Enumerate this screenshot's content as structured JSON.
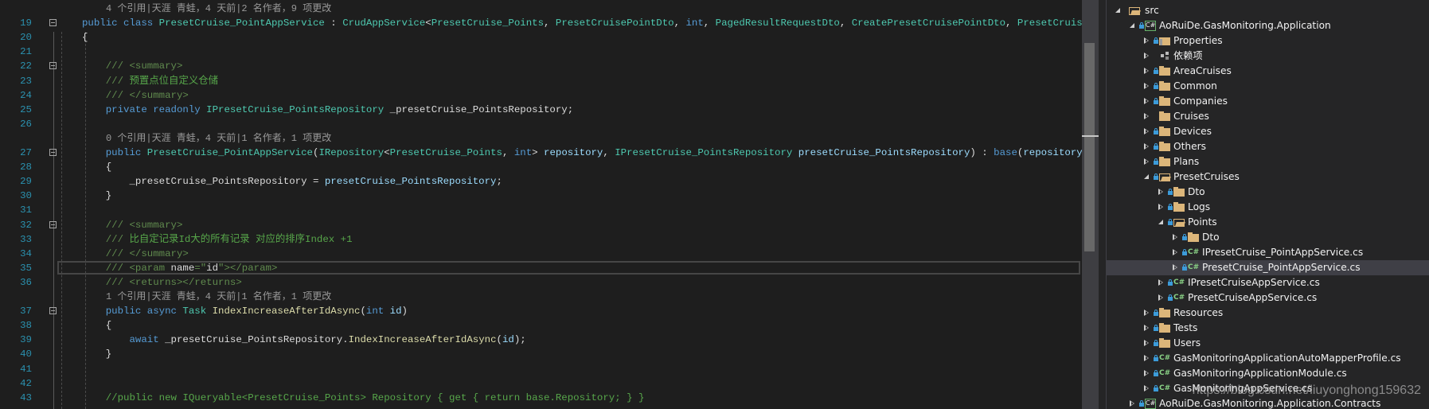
{
  "colors": {
    "background": "#1e1e1e",
    "line_number": "#2b91af",
    "keyword": "#569cd6",
    "type": "#4ec9b0",
    "comment": "#57a64a",
    "selection": "#3f3f46"
  },
  "editor": {
    "rows": [
      {
        "kind": "lens",
        "text": "4 个引用|天涯 青蛙，4 天前|2 名作者，9 项更改",
        "indent": "    "
      },
      {
        "num": "19",
        "fold": true,
        "tokens": [
          [
            "kw",
            "public class "
          ],
          [
            "ty",
            "PresetCruise_PointAppService"
          ],
          [
            "pl",
            " : "
          ],
          [
            "ty",
            "CrudAppService"
          ],
          [
            "pl",
            "<"
          ],
          [
            "ty",
            "PresetCruise_Points"
          ],
          [
            "pl",
            ", "
          ],
          [
            "ty",
            "PresetCruisePointDto"
          ],
          [
            "pl",
            ", "
          ],
          [
            "kw",
            "int"
          ],
          [
            "pl",
            ", "
          ],
          [
            "ty",
            "PagedResultRequestDto"
          ],
          [
            "pl",
            ", "
          ],
          [
            "ty",
            "CreatePresetCruisePointDto"
          ],
          [
            "pl",
            ", "
          ],
          [
            "ty",
            "PresetCruiseP"
          ]
        ]
      },
      {
        "num": "20",
        "tokens": [
          [
            "pl",
            "{"
          ]
        ]
      },
      {
        "num": "21",
        "tokens": []
      },
      {
        "num": "22",
        "fold": true,
        "tokens": [
          [
            "xd",
            "    /// <summary>"
          ]
        ]
      },
      {
        "num": "23",
        "tokens": [
          [
            "xd",
            "    /// "
          ],
          [
            "cm",
            "预置点位自定义仓储"
          ]
        ]
      },
      {
        "num": "24",
        "tokens": [
          [
            "xd",
            "    /// </summary>"
          ]
        ]
      },
      {
        "num": "25",
        "tokens": [
          [
            "kw",
            "    private readonly "
          ],
          [
            "ty",
            "IPresetCruise_PointsRepository"
          ],
          [
            "pl",
            " _presetCruise_PointsRepository;"
          ]
        ]
      },
      {
        "num": "26",
        "tokens": []
      },
      {
        "kind": "lens",
        "text": "0 个引用|天涯 青蛙，4 天前|1 名作者，1 项更改",
        "indent": "    "
      },
      {
        "num": "27",
        "fold": true,
        "tokens": [
          [
            "kw",
            "    public "
          ],
          [
            "ty",
            "PresetCruise_PointAppService"
          ],
          [
            "pl",
            "("
          ],
          [
            "ty",
            "IRepository"
          ],
          [
            "pl",
            "<"
          ],
          [
            "ty",
            "PresetCruise_Points"
          ],
          [
            "pl",
            ", "
          ],
          [
            "kw",
            "int"
          ],
          [
            "pl",
            "> "
          ],
          [
            "pa",
            "repository"
          ],
          [
            "pl",
            ", "
          ],
          [
            "ty",
            "IPresetCruise_PointsRepository"
          ],
          [
            "pa",
            " presetCruise_PointsRepository"
          ],
          [
            "pl",
            ") : "
          ],
          [
            "kw",
            "base"
          ],
          [
            "pl",
            "("
          ],
          [
            "pa",
            "repository"
          ],
          [
            "pl",
            ")"
          ]
        ]
      },
      {
        "num": "28",
        "tokens": [
          [
            "pl",
            "    {"
          ]
        ]
      },
      {
        "num": "29",
        "tokens": [
          [
            "pl",
            "        _presetCruise_PointsRepository = "
          ],
          [
            "pa",
            "presetCruise_PointsRepository"
          ],
          [
            "pl",
            ";"
          ]
        ]
      },
      {
        "num": "30",
        "tokens": [
          [
            "pl",
            "    }"
          ]
        ]
      },
      {
        "num": "31",
        "tokens": []
      },
      {
        "num": "32",
        "fold": true,
        "tokens": [
          [
            "xd",
            "    /// <summary>"
          ]
        ]
      },
      {
        "num": "33",
        "tokens": [
          [
            "xd",
            "    /// "
          ],
          [
            "cm",
            "比自定记录Id大的所有记录 对应的排序Index +1"
          ]
        ]
      },
      {
        "num": "34",
        "tokens": [
          [
            "xd",
            "    /// </summary>"
          ]
        ]
      },
      {
        "num": "35",
        "current": true,
        "tokens": [
          [
            "xd",
            "    /// <param "
          ],
          [
            "pl",
            "name"
          ],
          [
            "xd",
            "=\""
          ],
          [
            "pl",
            "id"
          ],
          [
            "xd",
            "\"></param>"
          ]
        ]
      },
      {
        "num": "36",
        "tokens": [
          [
            "xd",
            "    /// <returns></returns>"
          ]
        ]
      },
      {
        "kind": "lens",
        "text": "1 个引用|天涯 青蛙，4 天前|1 名作者，1 项更改",
        "indent": "    "
      },
      {
        "num": "37",
        "fold": true,
        "tokens": [
          [
            "kw",
            "    public async "
          ],
          [
            "ty",
            "Task"
          ],
          [
            "mt",
            " IndexIncreaseAfterIdAsync"
          ],
          [
            "pl",
            "("
          ],
          [
            "kw",
            "int"
          ],
          [
            "pa",
            " id"
          ],
          [
            "pl",
            ")"
          ]
        ]
      },
      {
        "num": "38",
        "tokens": [
          [
            "pl",
            "    {"
          ]
        ]
      },
      {
        "num": "39",
        "tokens": [
          [
            "kw",
            "        await"
          ],
          [
            "pl",
            " _presetCruise_PointsRepository."
          ],
          [
            "mt",
            "IndexIncreaseAfterIdAsync"
          ],
          [
            "pl",
            "("
          ],
          [
            "pa",
            "id"
          ],
          [
            "pl",
            ");"
          ]
        ]
      },
      {
        "num": "40",
        "tokens": [
          [
            "pl",
            "    }"
          ]
        ]
      },
      {
        "num": "41",
        "tokens": []
      },
      {
        "num": "42",
        "tokens": []
      },
      {
        "num": "43",
        "tokens": [
          [
            "cm",
            "    //public new IQueryable<PresetCruise_Points> Repository { get { return base.Repository; } }"
          ]
        ]
      }
    ]
  },
  "solution_explorer": {
    "items": [
      {
        "level": 0,
        "exp": "expanded",
        "lock": false,
        "icon": "folder-open",
        "label": "src"
      },
      {
        "level": 1,
        "exp": "expanded",
        "lock": true,
        "icon": "cs-project",
        "label": "AoRuiDe.GasMonitoring.Application"
      },
      {
        "level": 2,
        "exp": "collapsed",
        "lock": true,
        "icon": "properties",
        "label": "Properties"
      },
      {
        "level": 2,
        "exp": "collapsed",
        "lock": false,
        "icon": "dependencies",
        "label": "依赖项"
      },
      {
        "level": 2,
        "exp": "collapsed",
        "lock": true,
        "icon": "folder",
        "label": "AreaCruises"
      },
      {
        "level": 2,
        "exp": "collapsed",
        "lock": true,
        "icon": "folder",
        "label": "Common"
      },
      {
        "level": 2,
        "exp": "collapsed",
        "lock": true,
        "icon": "folder",
        "label": "Companies"
      },
      {
        "level": 2,
        "exp": "collapsed",
        "lock": false,
        "icon": "folder",
        "label": "Cruises"
      },
      {
        "level": 2,
        "exp": "collapsed",
        "lock": true,
        "icon": "folder",
        "label": "Devices"
      },
      {
        "level": 2,
        "exp": "collapsed",
        "lock": true,
        "icon": "folder",
        "label": "Others"
      },
      {
        "level": 2,
        "exp": "collapsed",
        "lock": true,
        "icon": "folder",
        "label": "Plans"
      },
      {
        "level": 2,
        "exp": "expanded",
        "lock": true,
        "icon": "folder-open",
        "label": "PresetCruises"
      },
      {
        "level": 3,
        "exp": "collapsed",
        "lock": true,
        "icon": "folder",
        "label": "Dto"
      },
      {
        "level": 3,
        "exp": "collapsed",
        "lock": true,
        "icon": "folder",
        "label": "Logs"
      },
      {
        "level": 3,
        "exp": "expanded",
        "lock": true,
        "icon": "folder-open",
        "label": "Points"
      },
      {
        "level": 4,
        "exp": "collapsed",
        "lock": true,
        "icon": "folder",
        "label": "Dto"
      },
      {
        "level": 4,
        "exp": "collapsed",
        "lock": true,
        "icon": "cs-file",
        "label": "IPresetCruise_PointAppService.cs"
      },
      {
        "level": 4,
        "exp": "collapsed",
        "lock": true,
        "icon": "cs-file",
        "label": "PresetCruise_PointAppService.cs",
        "selected": true
      },
      {
        "level": 3,
        "exp": "collapsed",
        "lock": true,
        "icon": "cs-file",
        "label": "IPresetCruiseAppService.cs"
      },
      {
        "level": 3,
        "exp": "collapsed",
        "lock": true,
        "icon": "cs-file",
        "label": "PresetCruiseAppService.cs"
      },
      {
        "level": 2,
        "exp": "collapsed",
        "lock": true,
        "icon": "folder",
        "label": "Resources"
      },
      {
        "level": 2,
        "exp": "collapsed",
        "lock": true,
        "icon": "folder",
        "label": "Tests"
      },
      {
        "level": 2,
        "exp": "collapsed",
        "lock": true,
        "icon": "folder",
        "label": "Users"
      },
      {
        "level": 2,
        "exp": "collapsed",
        "lock": true,
        "icon": "cs-file",
        "label": "GasMonitoringApplicationAutoMapperProfile.cs"
      },
      {
        "level": 2,
        "exp": "collapsed",
        "lock": true,
        "icon": "cs-file",
        "label": "GasMonitoringApplicationModule.cs"
      },
      {
        "level": 2,
        "exp": "collapsed",
        "lock": true,
        "icon": "cs-file",
        "label": "GasMonitoringAppService.cs"
      },
      {
        "level": 1,
        "exp": "collapsed",
        "lock": true,
        "icon": "cs-project",
        "label": "AoRuiDe.GasMonitoring.Application.Contracts"
      }
    ]
  },
  "icon_glyphs": {
    "cs": "C#"
  },
  "watermark": "https://blog.csdn.net/liuyonghong159632"
}
